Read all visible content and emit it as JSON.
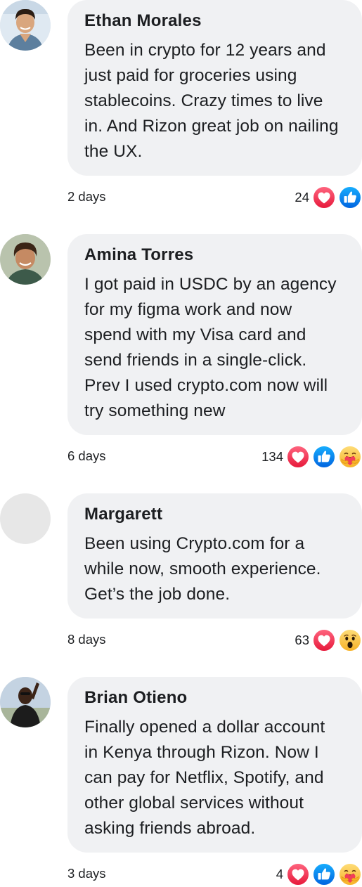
{
  "comments": [
    {
      "author": "Ethan Morales",
      "text": "Been in crypto for 12 years and\njust paid for groceries using\nstablecoins. Crazy times to live\nin. And Rizon great job on nailing\nthe UX.",
      "time": "2 days",
      "count": "24",
      "reactions": [
        "heart-icon",
        "like-icon"
      ]
    },
    {
      "author": "Amina Torres",
      "text": "I got paid in USDC by an agency\nfor my figma work and now\nspend with my Visa card and\nsend friends in a single-click.\nPrev I used crypto.com now will\ntry something new",
      "time": "6 days",
      "count": "134",
      "reactions": [
        "heart-icon",
        "like-icon",
        "care-icon"
      ]
    },
    {
      "author": "Margarett",
      "text": "Been using Crypto.com for a\nwhile now, smooth experience.\nGet’s the job done.",
      "time": "8 days",
      "count": "63",
      "reactions": [
        "heart-icon",
        "wow-icon"
      ]
    },
    {
      "author": "Brian Otieno",
      "text": "Finally opened a dollar account\nin Kenya through Rizon. Now I\ncan pay for Netflix, Spotify, and\nother global services without\nasking friends abroad.",
      "time": "3 days",
      "count": "4",
      "reactions": [
        "heart-icon",
        "like-icon",
        "care-icon"
      ]
    }
  ],
  "colors": {
    "bubble": "#f0f1f3",
    "heart": "#f33e58",
    "like": "#1877f2",
    "care": "#f7b125"
  }
}
